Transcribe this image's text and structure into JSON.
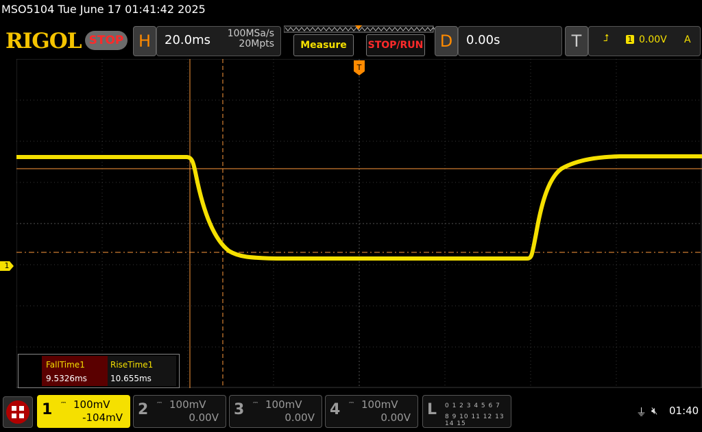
{
  "header": {
    "title": "MSO5104  Tue June 17 01:41:42 2025",
    "brand": "RIGOL",
    "status": "STOP"
  },
  "horizontal": {
    "label": "H",
    "timebase": "20.0ms",
    "sample_rate": "100MSa/s",
    "memory_depth": "20Mpts"
  },
  "buttons": {
    "measure": "Measure",
    "stop_run": "STOP/RUN"
  },
  "delay": {
    "label": "D",
    "value": "0.00s"
  },
  "trigger": {
    "label": "T",
    "channel": "1",
    "level": "0.00V",
    "mode": "A",
    "marker": "T"
  },
  "channel_marker": "1",
  "measurements": {
    "fall_label": "FallTime1",
    "fall_value": "9.5326ms",
    "rise_label": "RiseTime1",
    "rise_value": "10.655ms"
  },
  "channels": [
    {
      "num": "1",
      "scale": "100mV",
      "offset": "-104mV"
    },
    {
      "num": "2",
      "scale": "100mV",
      "offset": "0.00V"
    },
    {
      "num": "3",
      "scale": "100mV",
      "offset": "0.00V"
    },
    {
      "num": "4",
      "scale": "100mV",
      "offset": "0.00V"
    }
  ],
  "logic": {
    "label": "L",
    "row1": "0 1 2 3  4 5 6 7",
    "row2": "8 9 10 11 12 13 14 15"
  },
  "status_bar": {
    "clock": "01:40"
  },
  "colors": {
    "ch1": "#f5e000",
    "cursor": "#ff9a3c",
    "grid": "#3a3a3a",
    "accent": "#ff8a00"
  }
}
